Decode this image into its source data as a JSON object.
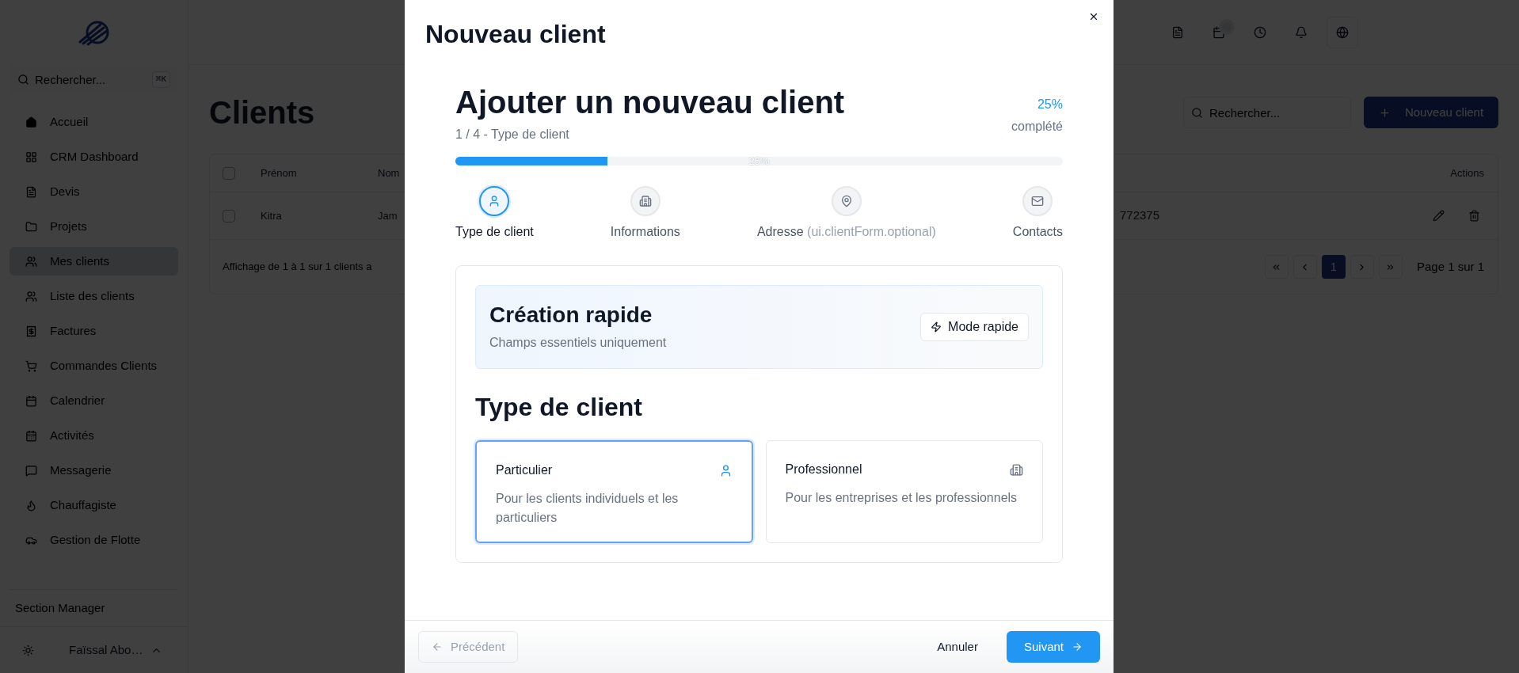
{
  "sidebar": {
    "search": {
      "placeholder": "Rechercher...",
      "shortcut": "⌘K"
    },
    "items": [
      {
        "label": "Accueil",
        "selected": false
      },
      {
        "label": "CRM Dashboard",
        "selected": false
      },
      {
        "label": "Devis",
        "selected": false
      },
      {
        "label": "Projets",
        "selected": false
      },
      {
        "label": "Mes clients",
        "selected": true
      },
      {
        "label": "Liste des clients",
        "selected": false
      },
      {
        "label": "Factures",
        "selected": false
      },
      {
        "label": "Commandes Clients",
        "selected": false
      },
      {
        "label": "Calendrier",
        "selected": false
      },
      {
        "label": "Activités",
        "selected": false
      },
      {
        "label": "Messagerie",
        "selected": false
      },
      {
        "label": "Chauffagiste",
        "selected": false
      },
      {
        "label": "Gestion de Flotte",
        "selected": false
      }
    ],
    "section_link": "Section Manager",
    "user": {
      "name": "Faïssal Abo…"
    }
  },
  "page": {
    "title": "Clients",
    "search": {
      "placeholder": "Rechercher..."
    },
    "new_button": "Nouveau client"
  },
  "table": {
    "header_checkbox": {
      "checked": false
    },
    "columns": [
      "Prénom",
      "Nom",
      "Actions"
    ],
    "rows": [
      {
        "checked": false,
        "cells": [
          "Kitra",
          "Jam",
          "772375"
        ]
      }
    ],
    "footer": "Affichage de 1 à 1 sur 1 clients a",
    "pages": [
      {
        "label": "1",
        "selected": true
      }
    ],
    "summary": "Page 1 sur 1"
  },
  "dialog": {
    "title": "Nouveau client",
    "heading": "Ajouter un nouveau client",
    "step_caption": "1 / 4 - Type de client",
    "percent": "25%",
    "percent_caption": "complété",
    "progress": {
      "level": 0.25,
      "label": "25%"
    },
    "steps": [
      {
        "label": "Type de client",
        "selected": true
      },
      {
        "label": "Informations",
        "selected": false
      },
      {
        "label": "Adresse",
        "hint": "(ui.clientForm.optional)",
        "selected": false
      },
      {
        "label": "Contacts",
        "selected": false
      }
    ],
    "quick": {
      "title": "Création rapide",
      "subtitle": "Champs essentiels uniquement",
      "button": "Mode rapide"
    },
    "section_title": "Type de client",
    "options": [
      {
        "title": "Particulier",
        "description": "Pour les clients individuels et les particuliers",
        "selected": true
      },
      {
        "title": "Professionnel",
        "description": "Pour les entreprises et les professionnels",
        "selected": false
      }
    ],
    "footer": {
      "back": {
        "label": "Précédent",
        "disabled": true
      },
      "cancel": "Annuler",
      "next": "Suivant"
    }
  }
}
